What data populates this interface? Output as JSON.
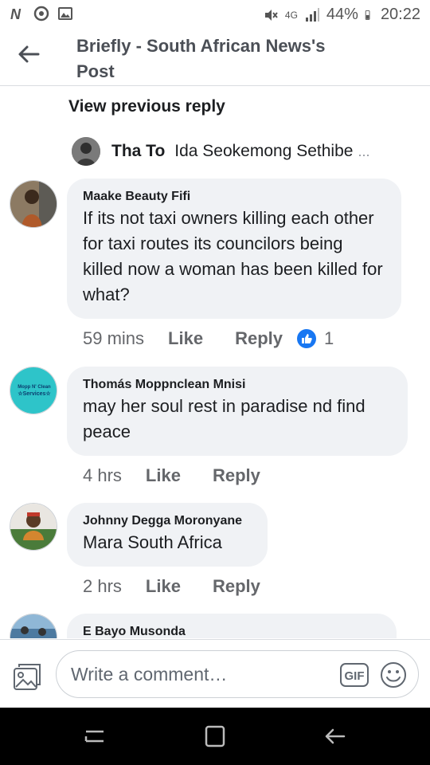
{
  "status_bar": {
    "battery": "44%",
    "time": "20:22",
    "network": "4G"
  },
  "header": {
    "title": "Briefly - South African News's Post"
  },
  "thread": {
    "view_previous": "View previous reply",
    "reply_preview": {
      "name": "Tha To",
      "text": "Ida Seokemong Sethibe",
      "ellipsis": "..."
    }
  },
  "comments": [
    {
      "name": "Maake Beauty Fifi",
      "text": "If its not taxi owners killing each other for taxi routes its councilors being killed now a woman has been killed for what?",
      "time": "59 mins",
      "like_label": "Like",
      "reply_label": "Reply",
      "reactions": "1"
    },
    {
      "name": "Thomás Moppnclean Mnisi",
      "text": "may her soul rest in paradise nd find peace",
      "time": "4 hrs",
      "like_label": "Like",
      "reply_label": "Reply"
    },
    {
      "name": "Johnny Degga Moronyane",
      "text": "Mara South Africa",
      "time": "2 hrs",
      "like_label": "Like",
      "reply_label": "Reply"
    },
    {
      "name": "E Bayo Musonda"
    }
  ],
  "composer": {
    "placeholder": "Write a comment…",
    "gif_label": "GIF"
  },
  "icons": {
    "back": "arrow-left-icon",
    "photo": "photo-icon",
    "gif": "gif-icon",
    "emoji": "emoji-icon",
    "like_reaction": "thumbs-up-icon"
  },
  "colors": {
    "bubble": "#f0f2f5",
    "meta_text": "#65676b",
    "like_blue": "#1877f2",
    "header_title": "#4b4f56"
  }
}
